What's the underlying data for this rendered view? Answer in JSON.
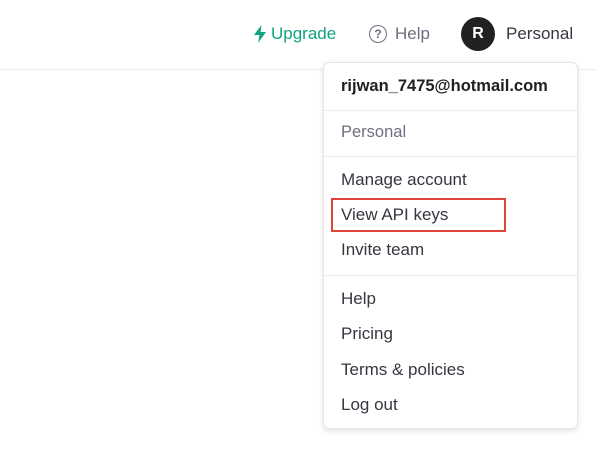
{
  "nav": {
    "upgrade_label": "Upgrade",
    "help_label": "Help",
    "help_icon_glyph": "?",
    "avatar_initial": "R",
    "account_label": "Personal"
  },
  "dropdown": {
    "email": "rijwan_7475@hotmail.com",
    "org": "Personal",
    "items": [
      {
        "label": "Manage account"
      },
      {
        "label": "View API keys"
      },
      {
        "label": "Invite team"
      },
      {
        "label": "Help"
      },
      {
        "label": "Pricing"
      },
      {
        "label": "Terms & policies"
      },
      {
        "label": "Log out"
      }
    ]
  },
  "colors": {
    "accent": "#10a37f",
    "highlight": "#e0443a",
    "avatar_bg": "#202123"
  },
  "icons": {
    "upgrade": "lightning-bolt-icon",
    "help": "question-circle-icon"
  }
}
